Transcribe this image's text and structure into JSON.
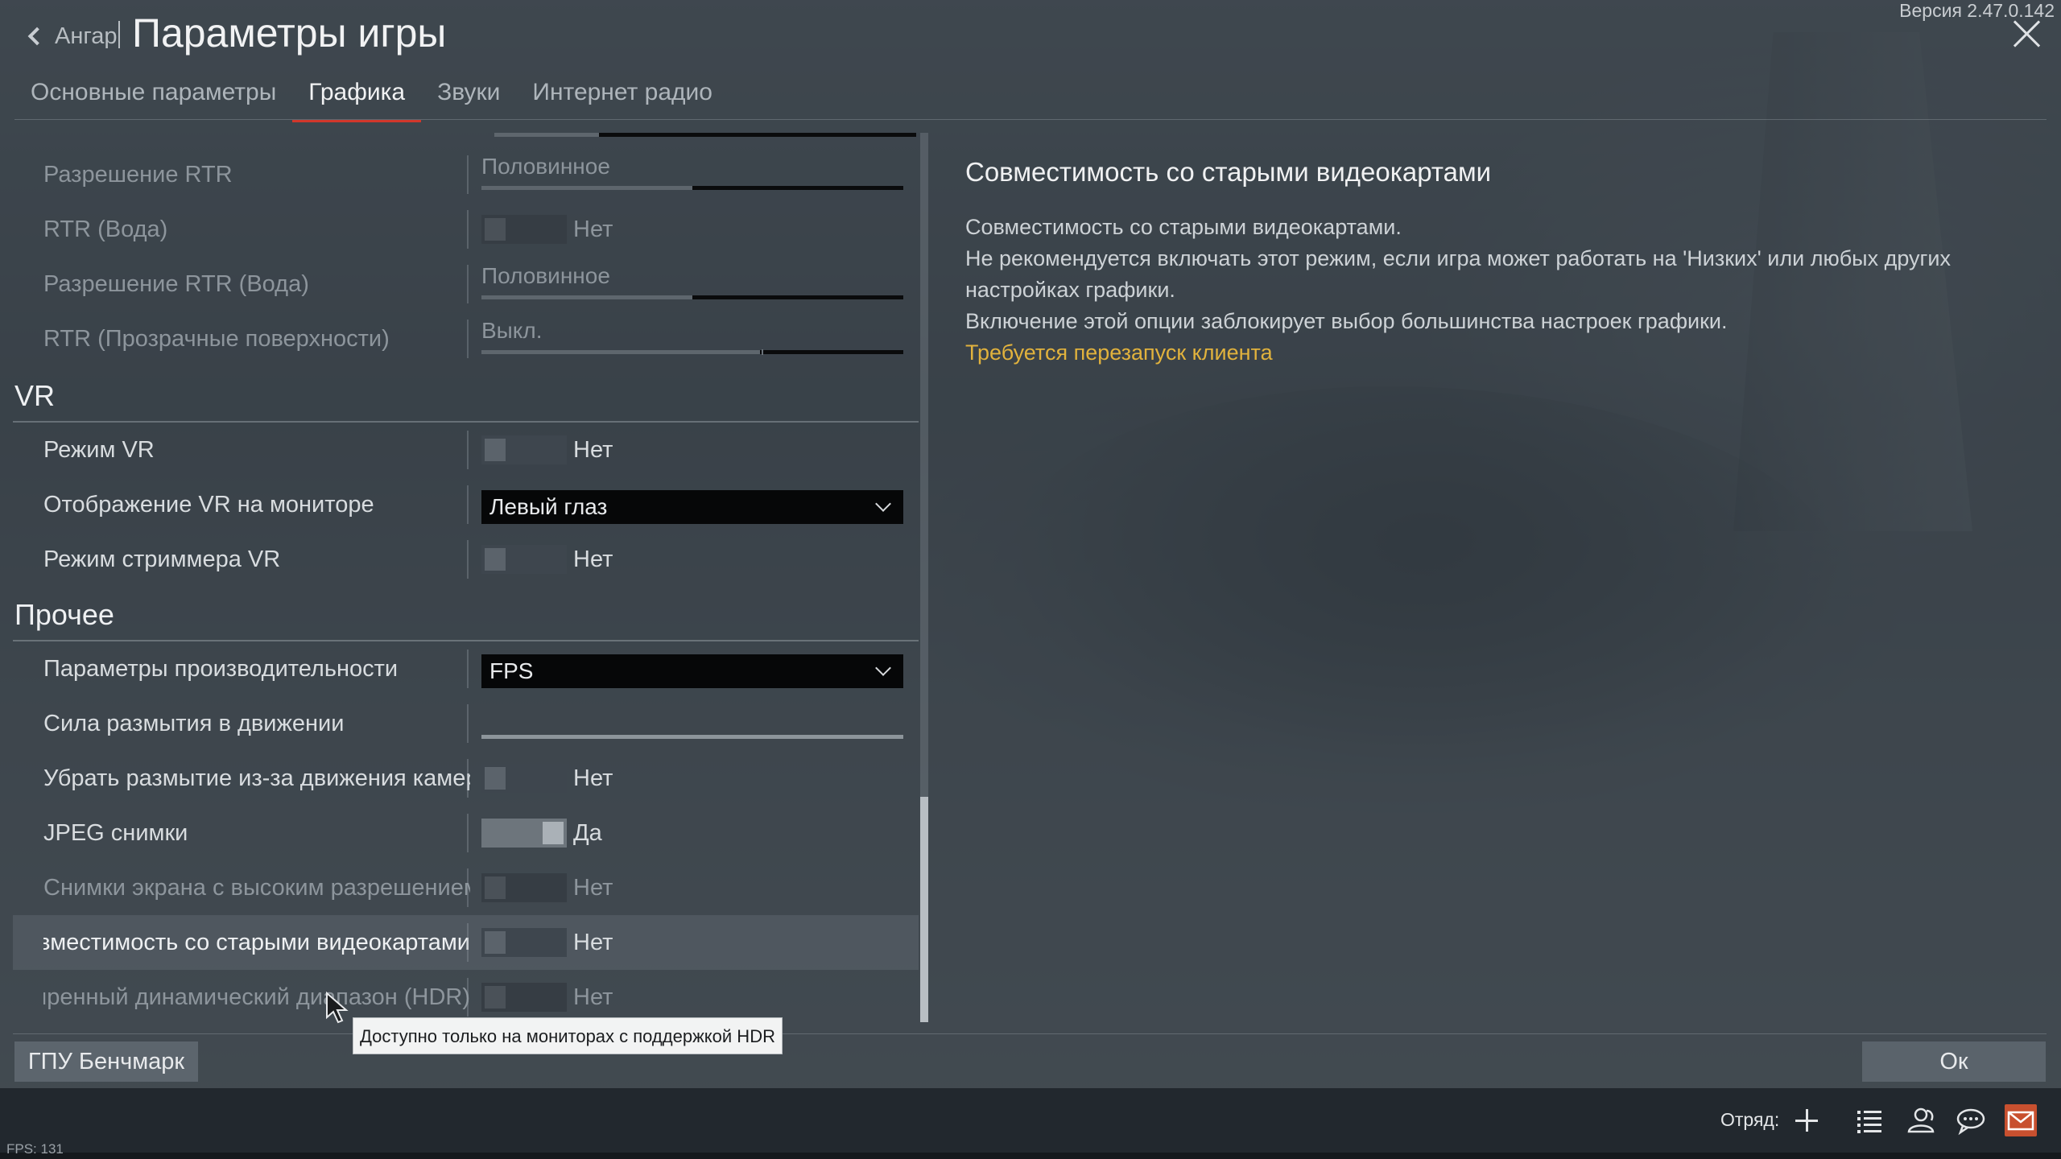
{
  "header": {
    "back_label": "Ангар",
    "title": "Параметры игры",
    "version": "Версия 2.47.0.142"
  },
  "tabs": [
    {
      "label": "Основные параметры",
      "active": false
    },
    {
      "label": "Графика",
      "active": true
    },
    {
      "label": "Звуки",
      "active": false
    },
    {
      "label": "Интернет радио",
      "active": false
    }
  ],
  "settings": {
    "rtr_resolution": {
      "label": "Разрешение RTR",
      "value": "Половинное",
      "level": 0.5
    },
    "rtr_water": {
      "label": "RTR (Вода)",
      "value": "Нет"
    },
    "rtr_water_resolution": {
      "label": "Разрешение RTR (Вода)",
      "value": "Половинное",
      "level": 0.5
    },
    "rtr_transparent": {
      "label": "RTR (Прозрачные поверхности)",
      "value": "Выкл.",
      "level": 0.66
    },
    "vr_section": "VR",
    "vr_mode": {
      "label": "Режим VR",
      "value": "Нет"
    },
    "vr_monitor": {
      "label": "Отображение VR на мониторе",
      "value": "Левый глаз"
    },
    "vr_streamer": {
      "label": "Режим стриммера VR",
      "value": "Нет"
    },
    "other_section": "Прочее",
    "performance": {
      "label": "Параметры производительности",
      "value": "FPS"
    },
    "motion_blur": {
      "label": "Сила размытия в движении",
      "level": 0.0
    },
    "camera_blur": {
      "label": "Убрать размытие из-за движения камеры",
      "value": "Нет"
    },
    "jpeg": {
      "label": "JPEG снимки",
      "value": "Да"
    },
    "hires_screens": {
      "label": "Снимки экрана с высоким разрешением",
      "value": "Нет"
    },
    "compat": {
      "label": "Совместимость со старыми видеокартами *",
      "value": "Нет"
    },
    "hdr": {
      "label": "Расширенный динамический диапазон (HDR)",
      "value": "Нет"
    }
  },
  "description": {
    "title": "Совместимость со старыми видеокартами",
    "lines": [
      "Совместимость со старыми видеокартами.",
      "Не рекомендуется включать этот режим, если игра может работать на 'Низких' или любых других",
      "настройках графики.",
      "Включение этой опции заблокирует выбор большинства настроек графики."
    ],
    "warning": "Требуется перезапуск клиента"
  },
  "tooltip": "Доступно только на мониторах с поддержкой HDR",
  "buttons": {
    "benchmark": "ГПУ Бенчмарк",
    "ok": "Ок"
  },
  "footer": {
    "fps": "FPS: 131",
    "squad_label": "Отряд:",
    "icons": [
      "plus-icon",
      "list-icon",
      "contacts-icon",
      "chat-icon",
      "mail-icon"
    ]
  },
  "colors": {
    "accent": "#d1372b",
    "warning": "#e1b23d",
    "mail": "#c8502f"
  }
}
